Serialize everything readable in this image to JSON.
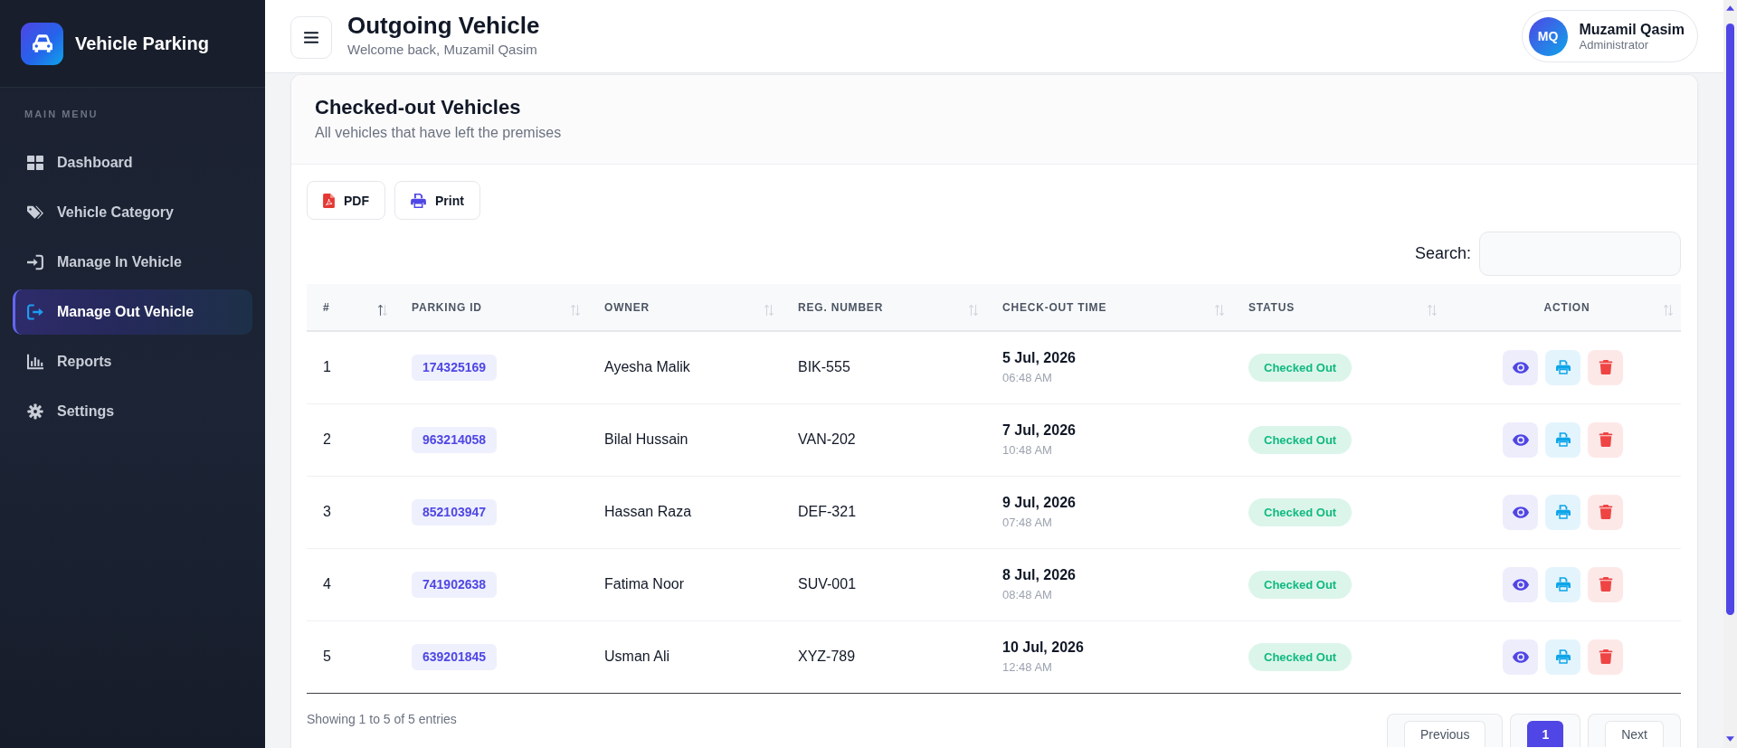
{
  "sidebar": {
    "brand": "Vehicle Parking",
    "section_title": "MAIN MENU",
    "items": [
      {
        "label": "Dashboard",
        "selected": false
      },
      {
        "label": "Vehicle Category",
        "selected": false
      },
      {
        "label": "Manage In Vehicle",
        "selected": false
      },
      {
        "label": "Manage Out Vehicle",
        "selected": true
      },
      {
        "label": "Reports",
        "selected": false
      },
      {
        "label": "Settings",
        "selected": false
      }
    ]
  },
  "header": {
    "title": "Outgoing Vehicle",
    "subtitle": "Welcome back, Muzamil Qasim",
    "user": {
      "initials": "MQ",
      "name": "Muzamil Qasim",
      "role": "Administrator"
    }
  },
  "card": {
    "title": "Checked-out Vehicles",
    "subtitle": "All vehicles that have left the premises",
    "export_buttons": [
      {
        "kind": "pdf",
        "label": "PDF"
      },
      {
        "kind": "print",
        "label": "Print"
      }
    ],
    "search": {
      "label": "Search:"
    }
  },
  "table": {
    "columns": [
      {
        "label": "#",
        "sorted": true
      },
      {
        "label": "PARKING ID",
        "sorted": false
      },
      {
        "label": "OWNER",
        "sorted": false
      },
      {
        "label": "REG. NUMBER",
        "sorted": false
      },
      {
        "label": "CHECK-OUT TIME",
        "sorted": false
      },
      {
        "label": "STATUS",
        "sorted": false
      },
      {
        "label": "ACTION",
        "sorted": false
      }
    ],
    "rows": [
      {
        "number": "1",
        "parking_id": "174325169",
        "owner": "Ayesha Malik",
        "reg_number": "BIK-555",
        "checkout_date": "5 Jul, 2026",
        "checkout_time": "06:48 AM",
        "status": "Checked Out"
      },
      {
        "number": "2",
        "parking_id": "963214058",
        "owner": "Bilal Hussain",
        "reg_number": "VAN-202",
        "checkout_date": "7 Jul, 2026",
        "checkout_time": "10:48 AM",
        "status": "Checked Out"
      },
      {
        "number": "3",
        "parking_id": "852103947",
        "owner": "Hassan Raza",
        "reg_number": "DEF-321",
        "checkout_date": "9 Jul, 2026",
        "checkout_time": "07:48 AM",
        "status": "Checked Out"
      },
      {
        "number": "4",
        "parking_id": "741902638",
        "owner": "Fatima Noor",
        "reg_number": "SUV-001",
        "checkout_date": "8 Jul, 2026",
        "checkout_time": "08:48 AM",
        "status": "Checked Out"
      },
      {
        "number": "5",
        "parking_id": "639201845",
        "owner": "Usman Ali",
        "reg_number": "XYZ-789",
        "checkout_date": "10 Jul, 2026",
        "checkout_time": "12:48 AM",
        "status": "Checked Out"
      }
    ]
  },
  "footer": {
    "info": "Showing 1 to 5 of 5 entries",
    "pagination": [
      {
        "label": "Previous",
        "selected": false
      },
      {
        "label": "1",
        "selected": true
      },
      {
        "label": "Next",
        "selected": false
      }
    ]
  }
}
